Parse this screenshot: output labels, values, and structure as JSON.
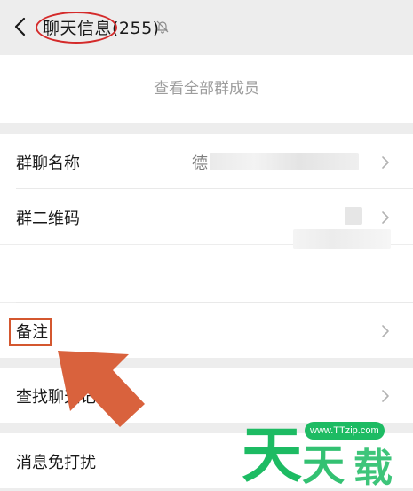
{
  "header": {
    "title": "聊天信息(255)",
    "back_icon": "chevron-left-icon",
    "mute_icon": "bell-off-icon"
  },
  "members": {
    "view_all_label": "查看全部群成员"
  },
  "settings": {
    "group_name_label": "群聊名称",
    "group_name_value": "德",
    "group_qr_label": "群二维码",
    "remark_label": "备注",
    "search_history_label": "查找聊天记录",
    "mute_label": "消息免打扰"
  },
  "annotations": {
    "ellipse_color": "#d42a2a",
    "box_color": "#d4572f",
    "arrow_color": "#d9623d"
  },
  "watermark": {
    "url_text": "www.TTzip.com",
    "logo_text": "天天下载",
    "color": "#1dbb63"
  }
}
